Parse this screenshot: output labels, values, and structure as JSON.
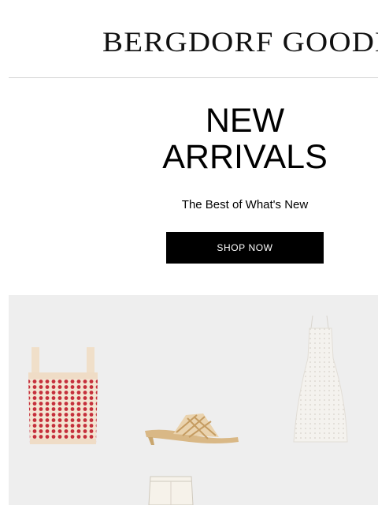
{
  "brand": {
    "name": "BERGDORF GOODMAN"
  },
  "hero": {
    "title_line1": "NEW",
    "title_line2": "ARRIVALS",
    "subtitle": "The Best of What's New",
    "cta_label": "SHOP NOW"
  },
  "products": [
    {
      "name": "red-white-knit-tank-top",
      "colors": [
        "#f1e2cf",
        "#c8313d"
      ]
    },
    {
      "name": "woven-kitten-heel-mule",
      "colors": [
        "#e8d2b0",
        "#c9a66e"
      ]
    },
    {
      "name": "white-eyelet-maxi-dress",
      "colors": [
        "#f4f2ee"
      ]
    },
    {
      "name": "cream-trousers",
      "colors": [
        "#f3efe6"
      ]
    }
  ]
}
